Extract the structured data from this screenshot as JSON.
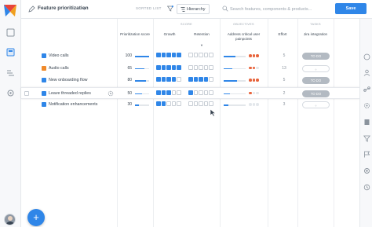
{
  "header": {
    "view_title": "Feature prioritization",
    "sorted_label": "SORTED LIST",
    "hierarchy_label": "Hierarchy",
    "search_placeholder": "Search features, components & products...",
    "save_label": "Save"
  },
  "columns": {
    "groups": {
      "scoring": "SCORE",
      "objectives": "OBJECTIVES",
      "tasks": "TASKS"
    },
    "prioritization_score": "Prioritization score",
    "growth": "Growth",
    "retention": "Retention",
    "pain_points": "Address critical user painpoints",
    "effort": "Effort",
    "jira": "Jira integration"
  },
  "rows": [
    {
      "name": "Video calls",
      "color": "#2f86e8",
      "score": "100",
      "score_fraction": 1.0,
      "growth": 5,
      "retention": 0,
      "pain_fraction": 0.55,
      "dots": [
        "#e8643c",
        "#e8643c",
        "#e8643c"
      ],
      "effort": "5",
      "jira": "TO DO",
      "jira_state": "todo"
    },
    {
      "name": "Audio calls",
      "color": "#f08a2b",
      "score": "65",
      "score_fraction": 0.65,
      "growth": 5,
      "retention": 0,
      "pain_fraction": 0.4,
      "dots": [
        "#e8643c",
        "#e8643c",
        "#e3e7eb"
      ],
      "effort": "13",
      "jira": "✧",
      "jira_state": "empty"
    },
    {
      "name": "New onboarding flow",
      "color": "#2f86e8",
      "score": "80",
      "score_fraction": 0.8,
      "growth": 4,
      "retention": 4,
      "pain_fraction": 0.6,
      "dots": [
        "#e8643c",
        "#e8643c",
        "#e8643c"
      ],
      "effort": "5",
      "jira": "TO DO",
      "jira_state": "todo"
    },
    {
      "name": "Leave threaded replies",
      "color": "#2f86e8",
      "score": "50",
      "score_fraction": 0.5,
      "growth": 3,
      "retention": 1,
      "pain_fraction": 0.3,
      "dots": [
        "#e8643c",
        "#e3e7eb",
        "#e3e7eb"
      ],
      "effort": "2",
      "jira": "TO DO",
      "jira_state": "todo"
    },
    {
      "name": "Notification enhancements",
      "color": "#2f86e8",
      "score": "30",
      "score_fraction": 0.3,
      "growth": 2,
      "retention": 0,
      "pain_fraction": 0.2,
      "dots": [
        "#e3e7eb",
        "#e3e7eb",
        "#e3e7eb"
      ],
      "effort": "3",
      "jira": "✧",
      "jira_state": "empty"
    }
  ],
  "icons": {
    "logo": "app-logo",
    "rail": [
      "inbox-icon",
      "roadmap-icon",
      "insights-icon",
      "settings-icon"
    ],
    "right_rail": [
      "visibility-icon",
      "person-icon",
      "link-icon",
      "gear-icon",
      "book-icon",
      "filter-icon",
      "flag-icon",
      "settings-icon",
      "history-icon"
    ]
  },
  "colors": {
    "accent": "#2f86e8",
    "dot_active": "#e8643c",
    "todo": "#b3bac2"
  }
}
